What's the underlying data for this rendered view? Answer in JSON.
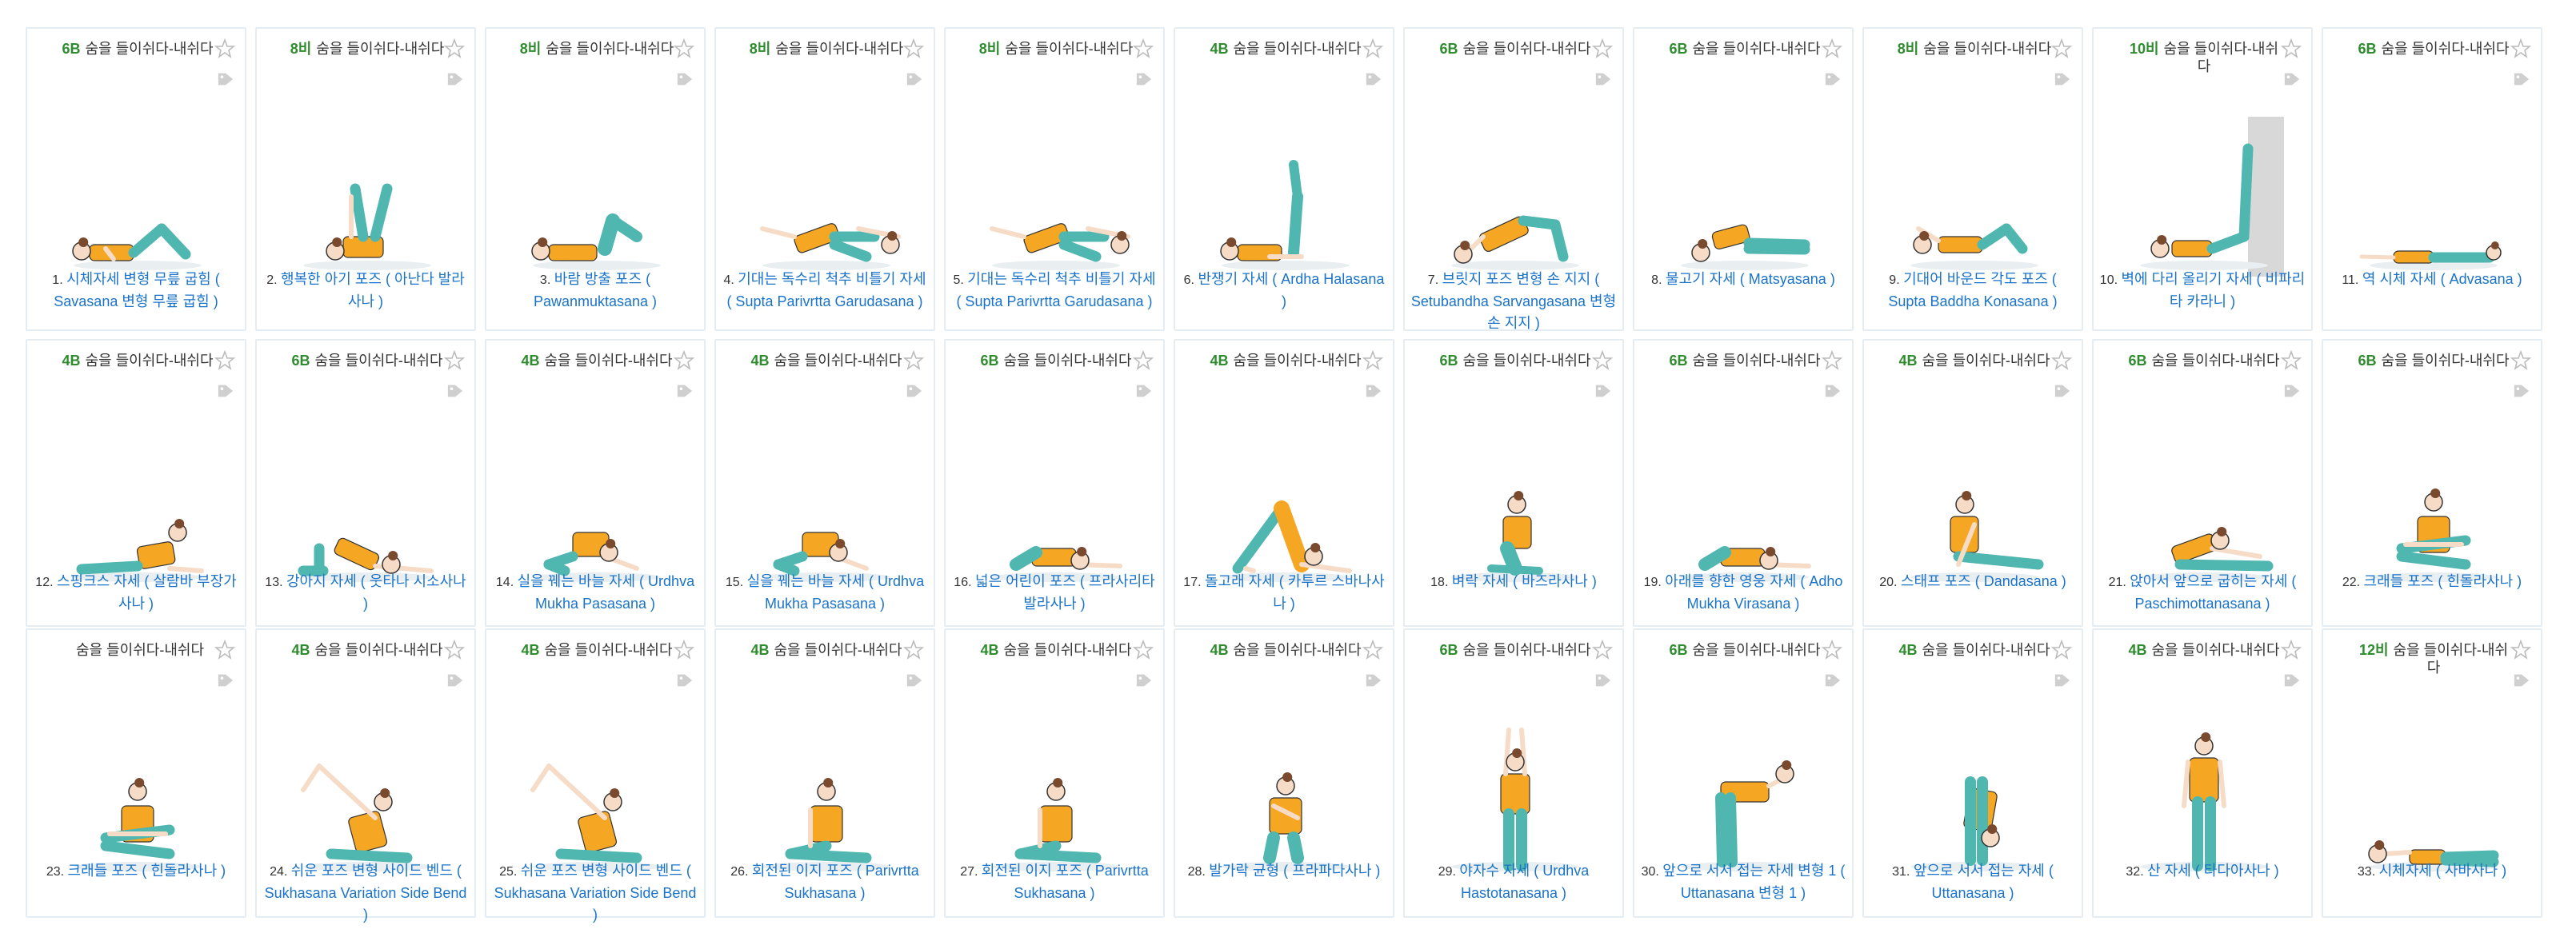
{
  "colors": {
    "accent_link": "#1a73c8",
    "count_green": "#2e8b2e",
    "shirt": "#f5a623",
    "pants": "#4fb6b0",
    "border": "#e6edf2"
  },
  "common_label": "숨을 들이쉬다-내쉬다",
  "poses": [
    {
      "n": "1.",
      "count": "6B",
      "title": "시체자세 변형 무릎 굽힘 ( Savasana 변형 무릎 굽힘 )",
      "fig": "lying-knees"
    },
    {
      "n": "2.",
      "count": "8비",
      "title": "행복한 아기 포즈 ( 아난다 발라사나 )",
      "fig": "happy-baby"
    },
    {
      "n": "3.",
      "count": "8비",
      "title": "바람 방출 포즈 ( Pawanmuktasana )",
      "fig": "wind"
    },
    {
      "n": "4.",
      "count": "8비",
      "title": "기대는 독수리 척추 비틀기 자세 ( Supta Parivrtta Garudasana )",
      "fig": "twist"
    },
    {
      "n": "5.",
      "count": "8비",
      "title": "기대는 독수리 척추 비틀기 자세 ( Supta Parivrtta Garudasana )",
      "fig": "twist"
    },
    {
      "n": "6.",
      "count": "4B",
      "title": "반쟁기 자세 ( Ardha Halasana )",
      "fig": "half-plow"
    },
    {
      "n": "7.",
      "count": "6B",
      "title": "브릿지 포즈 변형 손 지지 ( Setubandha Sarvangasana 변형 손 지지 )",
      "fig": "bridge"
    },
    {
      "n": "8.",
      "count": "6B",
      "title": "물고기 자세 ( Matsyasana )",
      "fig": "fish"
    },
    {
      "n": "9.",
      "count": "8비",
      "title": "기대어 바운드 각도 포즈 ( Supta Baddha Konasana )",
      "fig": "bound"
    },
    {
      "n": "10.",
      "count": "10비",
      "title": "벽에 다리 올리기 자세 ( 비파리타 카라니 )",
      "fig": "wall"
    },
    {
      "n": "11.",
      "count": "6B",
      "title": "역 시체 자세 ( Advasana )",
      "fig": "prone"
    },
    {
      "n": "12.",
      "count": "4B",
      "title": "스핑크스 자세 ( 살람바 부장가사나 )",
      "fig": "sphinx"
    },
    {
      "n": "13.",
      "count": "6B",
      "title": "강아지 자세 ( 웃타나 시소사나 )",
      "fig": "puppy"
    },
    {
      "n": "14.",
      "count": "4B",
      "title": "실을 꿰는 바늘 자세 ( Urdhva Mukha Pasasana )",
      "fig": "thread"
    },
    {
      "n": "15.",
      "count": "4B",
      "title": "실을 꿰는 바늘 자세 ( Urdhva Mukha Pasasana )",
      "fig": "thread"
    },
    {
      "n": "16.",
      "count": "6B",
      "title": "넓은 어린이 포즈 ( 프라사리타 발라사나 )",
      "fig": "child"
    },
    {
      "n": "17.",
      "count": "4B",
      "title": "돌고래 자세 ( 카투르 스바나사나 )",
      "fig": "dolphin"
    },
    {
      "n": "18.",
      "count": "6B",
      "title": "벼락 자세 ( 바즈라사나 )",
      "fig": "kneel"
    },
    {
      "n": "19.",
      "count": "6B",
      "title": "아래를 향한 영웅 자세 ( Adho Mukha Virasana )",
      "fig": "child"
    },
    {
      "n": "20.",
      "count": "4B",
      "title": "스태프 포즈 ( Dandasana )",
      "fig": "staff"
    },
    {
      "n": "21.",
      "count": "6B",
      "title": "앉아서 앞으로 굽히는 자세 ( Paschimottanasana )",
      "fig": "fold"
    },
    {
      "n": "22.",
      "count": "6B",
      "title": "크래들 포즈 ( 힌돌라사나 )",
      "fig": "cradle"
    },
    {
      "n": "23.",
      "count": "",
      "title": "크래들 포즈 ( 힌돌라사나 )",
      "fig": "cradle"
    },
    {
      "n": "24.",
      "count": "4B",
      "title": "쉬운 포즈 변형 사이드 벤드 ( Sukhasana Variation Side Bend )",
      "fig": "sidebend"
    },
    {
      "n": "25.",
      "count": "4B",
      "title": "쉬운 포즈 변형 사이드 벤드 ( Sukhasana Variation Side Bend )",
      "fig": "sidebend"
    },
    {
      "n": "26.",
      "count": "4B",
      "title": "회전된 이지 포즈 ( Parivrtta Sukhasana )",
      "fig": "easy"
    },
    {
      "n": "27.",
      "count": "4B",
      "title": "회전된 이지 포즈 ( Parivrtta Sukhasana )",
      "fig": "easy"
    },
    {
      "n": "28.",
      "count": "4B",
      "title": "발가락 균형 ( 프라파다사나 )",
      "fig": "squat"
    },
    {
      "n": "29.",
      "count": "6B",
      "title": "야자수 자세 ( Urdhva Hastotanasana )",
      "fig": "arms-up"
    },
    {
      "n": "30.",
      "count": "6B",
      "title": "앞으로 서서 접는 자세 변형 1 ( Uttanasana 변형 1 )",
      "fig": "half-fold"
    },
    {
      "n": "31.",
      "count": "4B",
      "title": "앞으로 서서 접는 자세 ( Uttanasana )",
      "fig": "forward-fold"
    },
    {
      "n": "32.",
      "count": "4B",
      "title": "산 자세 ( 타다아사나 )",
      "fig": "stand"
    },
    {
      "n": "33.",
      "count": "12비",
      "title": "시체자세 ( 사바사나 )",
      "fig": "lying"
    }
  ]
}
